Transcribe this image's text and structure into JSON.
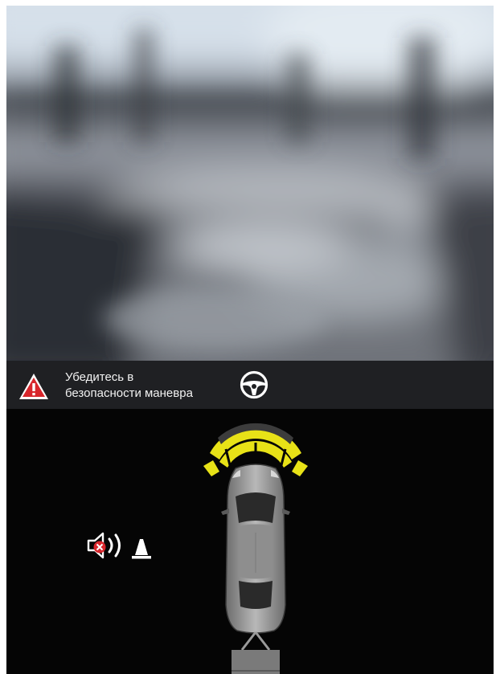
{
  "warning": {
    "line1": "Убедитесь в",
    "line2": "безопасности маневра",
    "icon": "warning-triangle-icon"
  },
  "icons": {
    "steering": "steering-wheel-icon",
    "sound": "sound-muted-icon",
    "sensor": "parking-sensor-cone-icon"
  },
  "colors": {
    "sensor_active": "#e8e217",
    "sensor_inactive": "#4a4a4a",
    "warning_red": "#d8262c",
    "background": "#050505",
    "bar": "#1f2023"
  },
  "sensors": {
    "front_active_zones": 4,
    "front_total_zones": 4
  }
}
